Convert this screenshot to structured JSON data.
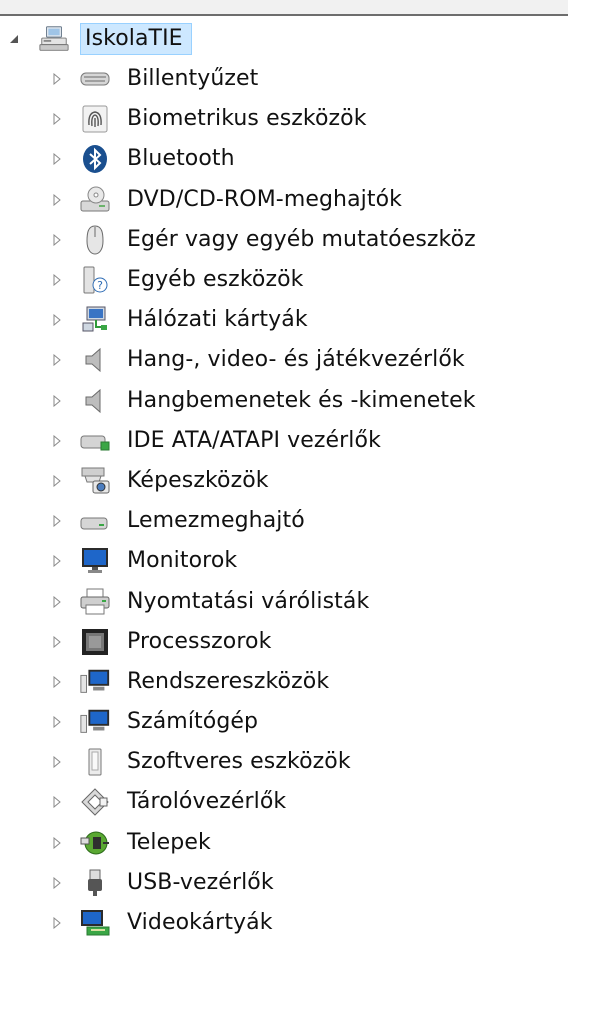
{
  "window": {
    "top_strip": ""
  },
  "root": {
    "label": "IskolaTIE",
    "expanded": true,
    "icon": "computer-network-icon",
    "selected": true
  },
  "categories": [
    {
      "label": "Billentyűzet",
      "icon": "keyboard-icon"
    },
    {
      "label": "Biometrikus eszközök",
      "icon": "fingerprint-icon"
    },
    {
      "label": "Bluetooth",
      "icon": "bluetooth-icon"
    },
    {
      "label": "DVD/CD-ROM-meghajtók",
      "icon": "optical-drive-icon"
    },
    {
      "label": "Egér vagy egyéb mutatóeszköz",
      "icon": "mouse-icon"
    },
    {
      "label": "Egyéb eszközök",
      "icon": "unknown-device-icon"
    },
    {
      "label": "Hálózati kártyák",
      "icon": "network-adapter-icon"
    },
    {
      "label": "Hang-, video- és játékvezérlők",
      "icon": "speaker-icon"
    },
    {
      "label": "Hangbemenetek és -kimenetek",
      "icon": "speaker-icon"
    },
    {
      "label": "IDE ATA/ATAPI vezérlők",
      "icon": "ide-controller-icon"
    },
    {
      "label": "Képeszközök",
      "icon": "imaging-device-icon"
    },
    {
      "label": "Lemezmeghajtó",
      "icon": "disk-drive-icon"
    },
    {
      "label": "Monitorok",
      "icon": "monitor-icon"
    },
    {
      "label": "Nyomtatási várólisták",
      "icon": "printer-icon"
    },
    {
      "label": "Processzorok",
      "icon": "processor-icon"
    },
    {
      "label": "Rendszereszközök",
      "icon": "system-device-icon"
    },
    {
      "label": "Számítógép",
      "icon": "computer-icon"
    },
    {
      "label": "Szoftveres eszközök",
      "icon": "software-device-icon"
    },
    {
      "label": "Tárolóvezérlők",
      "icon": "storage-controller-icon"
    },
    {
      "label": "Telepek",
      "icon": "battery-icon"
    },
    {
      "label": "USB-vezérlők",
      "icon": "usb-icon"
    },
    {
      "label": "Videokártyák",
      "icon": "display-adapter-icon"
    }
  ],
  "colors": {
    "selection_bg": "#cde8ff",
    "selection_border": "#99d1ff",
    "expander": "#7a7a7a"
  }
}
